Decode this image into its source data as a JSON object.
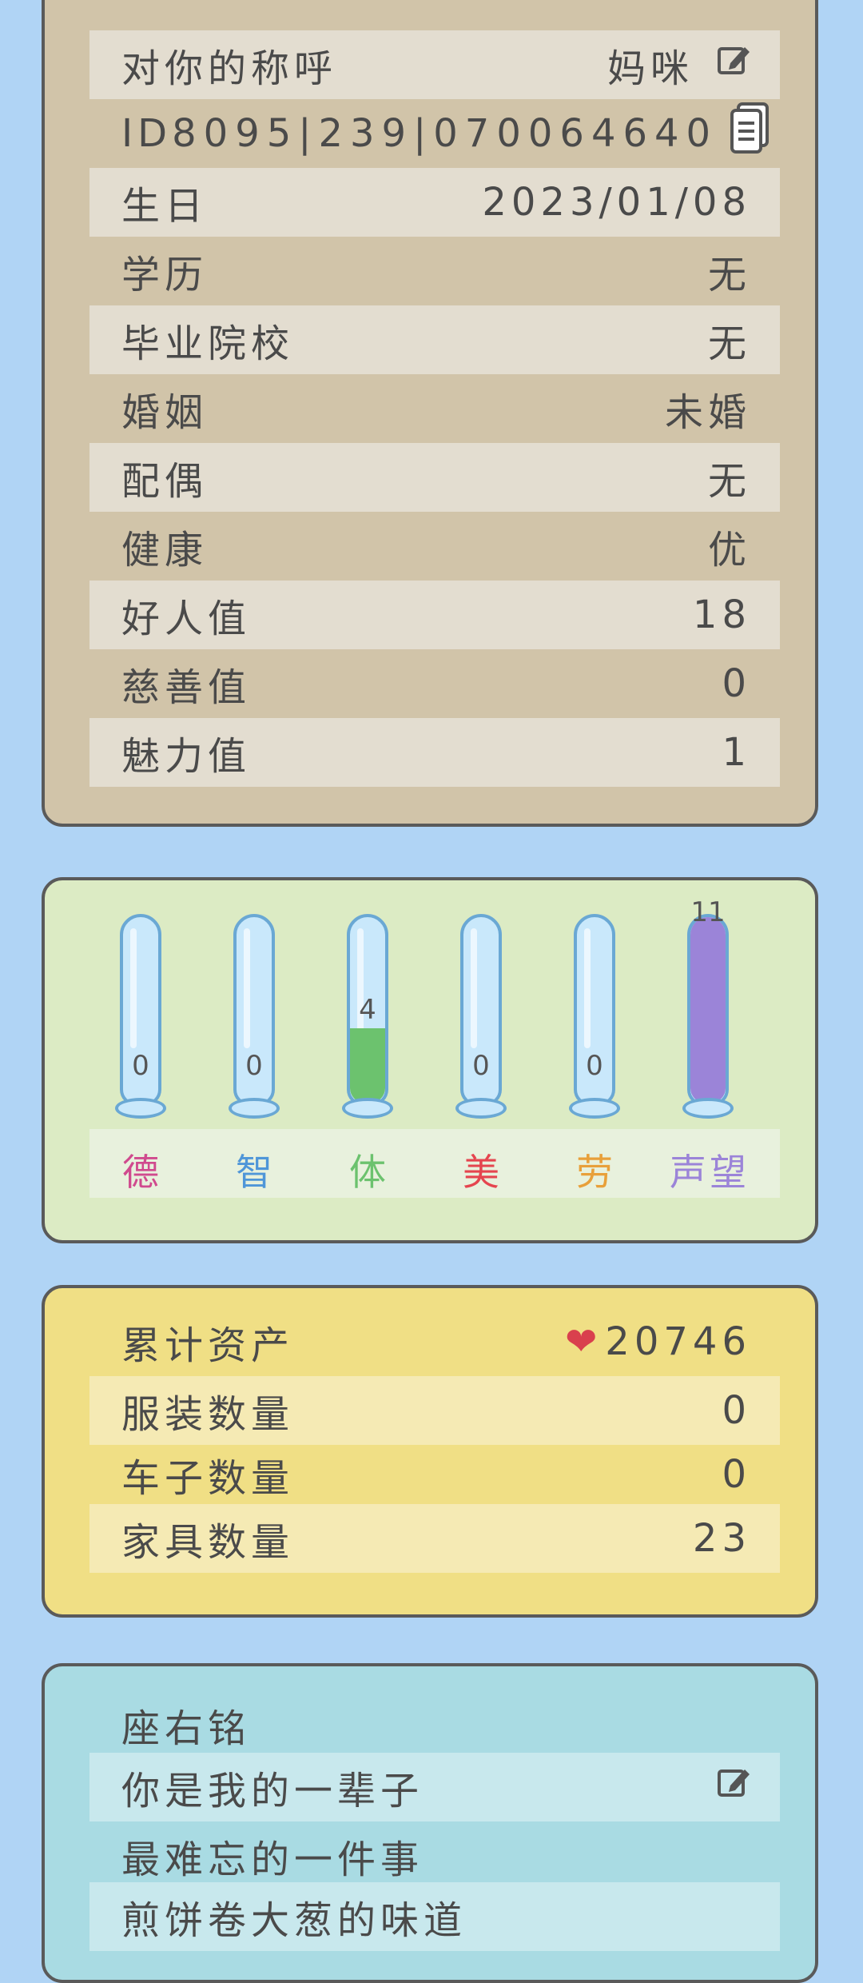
{
  "profile": {
    "rows": [
      {
        "label": "对你的称呼",
        "value": "妈咪"
      },
      {
        "label": "ID",
        "value": "8095|239|070064640"
      },
      {
        "label": "生日",
        "value": "2023/01/08"
      },
      {
        "label": "学历",
        "value": "无"
      },
      {
        "label": "毕业院校",
        "value": "无"
      },
      {
        "label": "婚姻",
        "value": "未婚"
      },
      {
        "label": "配偶",
        "value": "无"
      },
      {
        "label": "健康",
        "value": "优"
      },
      {
        "label": "好人值",
        "value": "18"
      },
      {
        "label": "慈善值",
        "value": "0"
      },
      {
        "label": "魅力值",
        "value": "1"
      }
    ],
    "edit_icon": "edit-icon",
    "copy_icon": "copy-icon"
  },
  "stats": {
    "items": [
      {
        "label": "德",
        "value": "0",
        "color": "#d04a8e",
        "fill_color": "",
        "fill_fraction": 0
      },
      {
        "label": "智",
        "value": "0",
        "color": "#4f96d8",
        "fill_color": "",
        "fill_fraction": 0
      },
      {
        "label": "体",
        "value": "4",
        "color": "#6cc26e",
        "fill_color": "#6cc26e",
        "fill_fraction": 0.4
      },
      {
        "label": "美",
        "value": "0",
        "color": "#e5454f",
        "fill_color": "",
        "fill_fraction": 0
      },
      {
        "label": "劳",
        "value": "0",
        "color": "#e8a03a",
        "fill_color": "",
        "fill_fraction": 0
      },
      {
        "label": "声望",
        "value": "11",
        "color": "#9b84d8",
        "fill_color": "#9b84d8",
        "fill_fraction": 1.0
      }
    ]
  },
  "assets": {
    "rows": [
      {
        "label": "累计资产",
        "value": "20746"
      },
      {
        "label": "服装数量",
        "value": "0"
      },
      {
        "label": "车子数量",
        "value": "0"
      },
      {
        "label": "家具数量",
        "value": "23"
      }
    ],
    "heart_icon": "heart-icon"
  },
  "motto": {
    "title": "座右铭",
    "text": "你是我的一辈子",
    "memory_title": "最难忘的一件事",
    "memory_text": "煎饼卷大葱的味道"
  }
}
